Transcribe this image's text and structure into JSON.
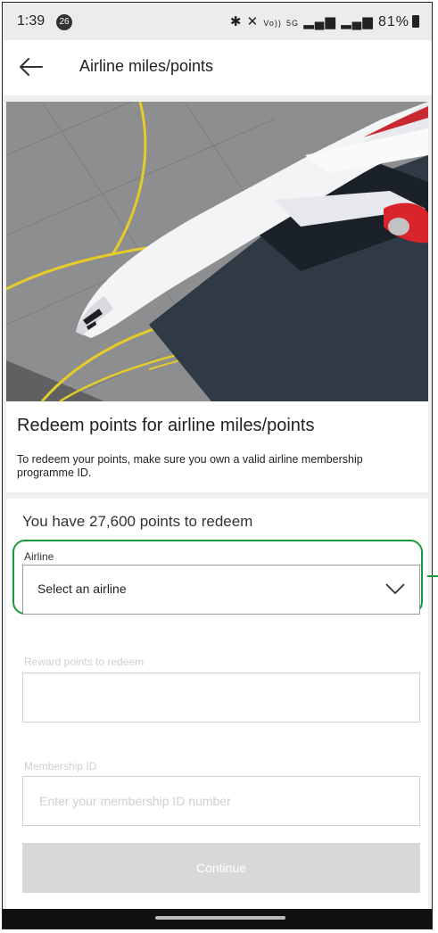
{
  "status_bar": {
    "time": "1:39",
    "notification_count": "26",
    "battery_percent": "81%",
    "icons": [
      "bluetooth-icon",
      "mute-icon",
      "volte-icon",
      "5g-icon",
      "signal-icon",
      "signal-icon",
      "battery-icon"
    ],
    "network_label_1": "Vo))",
    "network_label_2": "5G"
  },
  "app_bar": {
    "title": "Airline miles/points",
    "back_icon": "arrow-left-icon"
  },
  "hero": {
    "heading": "Redeem points for airline miles/points",
    "description": "To redeem your points, make sure you own a valid airline membership programme ID."
  },
  "form": {
    "points_summary": "You have 27,600 points to redeem",
    "airline": {
      "label": "Airline",
      "value": "Select an airline",
      "icon": "chevron-down-icon"
    },
    "reward_points": {
      "label": "Reward points to redeem",
      "value": ""
    },
    "membership": {
      "label": "Membership ID",
      "placeholder": "Enter your membership ID number"
    },
    "continue_label": "Continue"
  },
  "colors": {
    "highlight": "#1a9a3a",
    "disabled_button": "#d8d8d8",
    "background": "#efefef"
  }
}
